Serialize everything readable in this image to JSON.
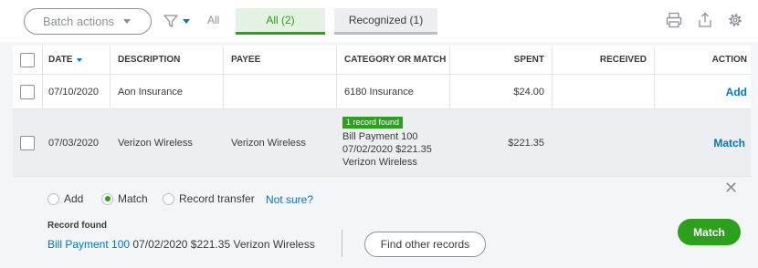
{
  "toolbar": {
    "batch_actions_label": "Batch actions",
    "filter_all_label": "All",
    "tabs": [
      {
        "label": "All (2)",
        "active": true
      },
      {
        "label": "Recognized (1)",
        "active": false
      }
    ],
    "icons": [
      "print-icon",
      "export-icon",
      "settings-gear-icon"
    ]
  },
  "table": {
    "columns": [
      "DATE",
      "DESCRIPTION",
      "PAYEE",
      "CATEGORY OR MATCH",
      "SPENT",
      "RECEIVED",
      "ACTION"
    ],
    "rows": [
      {
        "date": "07/10/2020",
        "description": "Aon Insurance",
        "payee": "",
        "category": "6180 Insurance",
        "spent": "$24.00",
        "received": "",
        "action": "Add"
      },
      {
        "date": "07/03/2020",
        "description": "Verizon Wireless",
        "payee": "Verizon Wireless",
        "match_badge": "1 record found",
        "match_line1": "Bill Payment 100",
        "match_line2": "07/02/2020 $221.35",
        "match_line3": "Verizon Wireless",
        "spent": "$221.35",
        "received": "",
        "action": "Match"
      }
    ]
  },
  "detail": {
    "radios": [
      {
        "label": "Add",
        "selected": false
      },
      {
        "label": "Match",
        "selected": true
      },
      {
        "label": "Record transfer",
        "selected": false
      }
    ],
    "not_sure_link": "Not sure?",
    "record_found_label": "Record found",
    "record_link": "Bill Payment 100",
    "record_rest": " 07/02/2020 $221.35 Verizon Wireless",
    "find_other_label": "Find other records",
    "match_button_label": "Match",
    "close_glyph": "✕"
  },
  "colors": {
    "accent_green": "#2ca01c",
    "link_blue": "#0077c5",
    "text": "#393a3d"
  }
}
